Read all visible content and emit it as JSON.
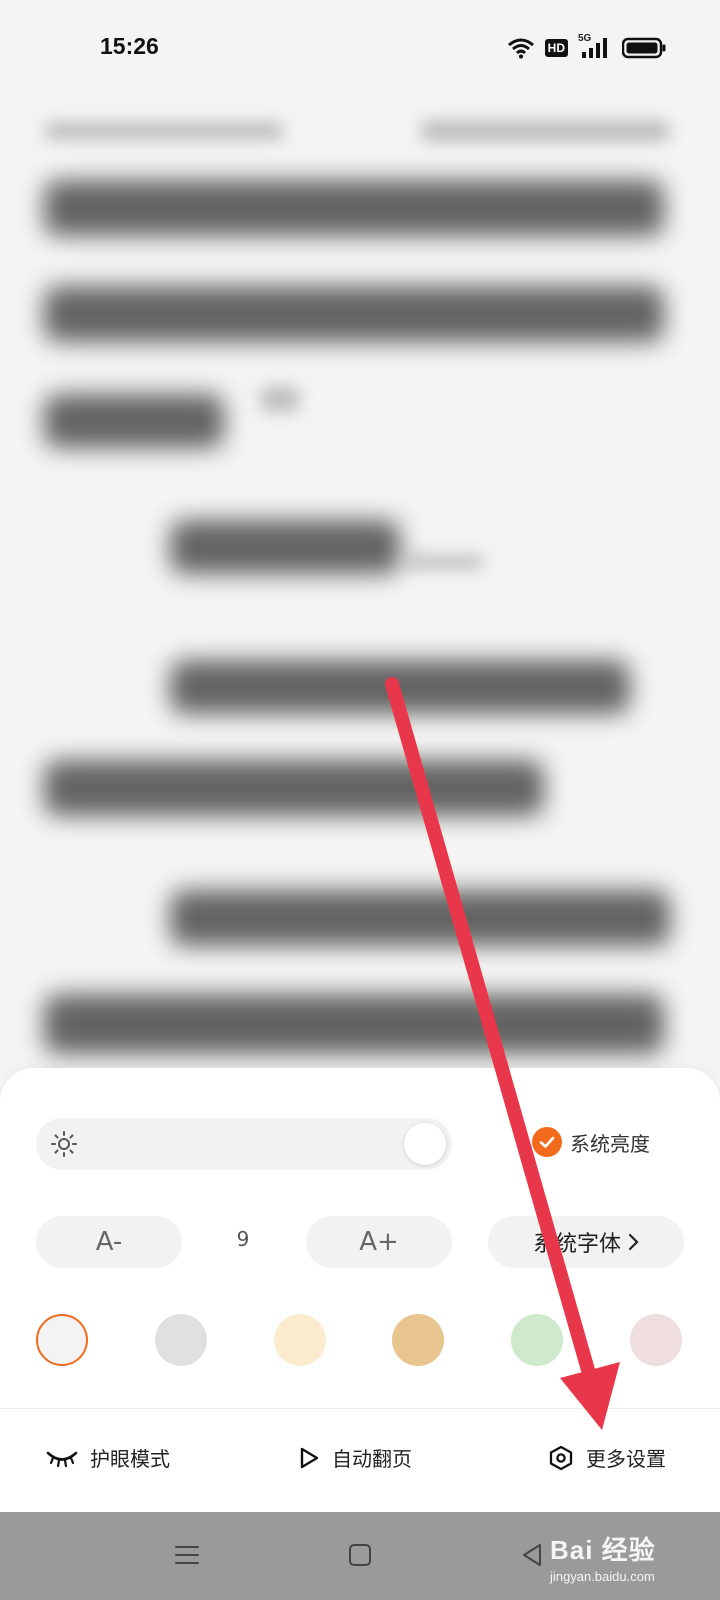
{
  "status_bar": {
    "time": "15:26",
    "hd": "HD",
    "network": "5G"
  },
  "settings": {
    "system_brightness_label": "系统亮度",
    "system_brightness_checked": true,
    "font_decrease_label": "A-",
    "font_size_value": "9",
    "font_increase_label": "A+",
    "font_family_label": "系统字体",
    "themes": [
      {
        "color": "#f3f3f3",
        "selected": true
      },
      {
        "color": "#e0e0e0",
        "selected": false
      },
      {
        "color": "#fbecd0",
        "selected": false
      },
      {
        "color": "#e8c48f",
        "selected": false
      },
      {
        "color": "#cfe9cc",
        "selected": false
      },
      {
        "color": "#f1dede",
        "selected": false
      }
    ],
    "accent_color": "#f26b1d"
  },
  "actions": {
    "eye_mode": "护眼模式",
    "auto_page": "自动翻页",
    "more_settings": "更多设置"
  },
  "watermark": {
    "main": "Bai 经验",
    "sub": "jingyan.baidu.com"
  },
  "annotation": {
    "color": "#e8374a"
  }
}
